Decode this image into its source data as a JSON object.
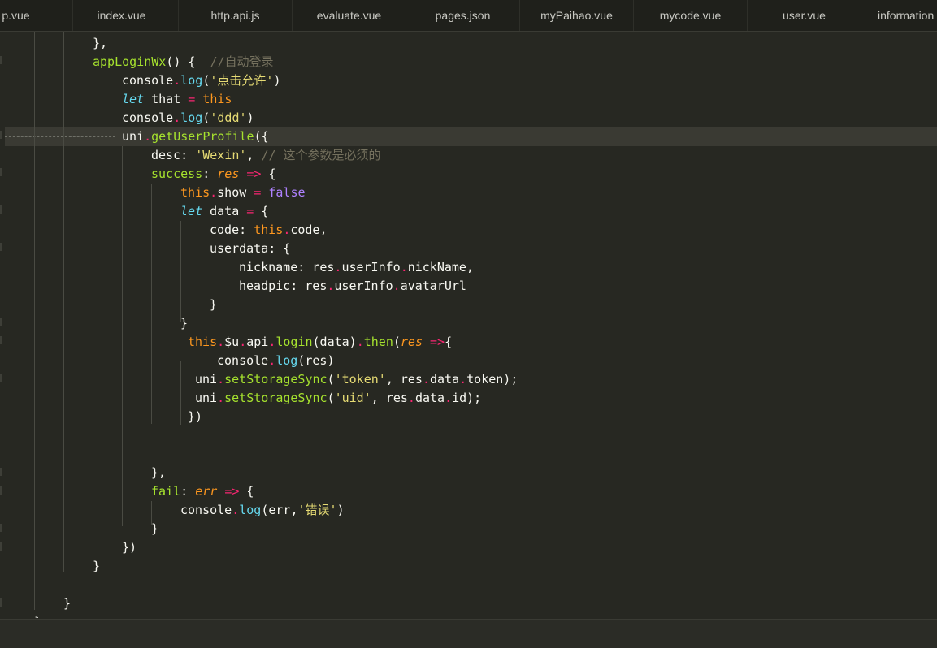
{
  "tabs": [
    "p.vue",
    "index.vue",
    "http.api.js",
    "evaluate.vue",
    "pages.json",
    "myPaihao.vue",
    "mycode.vue",
    "user.vue",
    "information"
  ],
  "code": {
    "line01": "},",
    "line02_fn": "appLoginWx",
    "line02_comment": "//自动登录",
    "line03_str": "'点击允许'",
    "line05_str": "'ddd'",
    "line06_fn": "getUserProfile",
    "line07_str": "'Wexin'",
    "line07_comment": "// 这个参数是必须的",
    "line20_str": "'token'",
    "line21_str": "'uid'",
    "line27_str": "'错误'"
  },
  "colors": {
    "background": "#272822",
    "keyword": "#f92672",
    "string": "#e6db74",
    "function": "#a6e22e",
    "builtin": "#66d9ef",
    "comment": "#75715e"
  }
}
